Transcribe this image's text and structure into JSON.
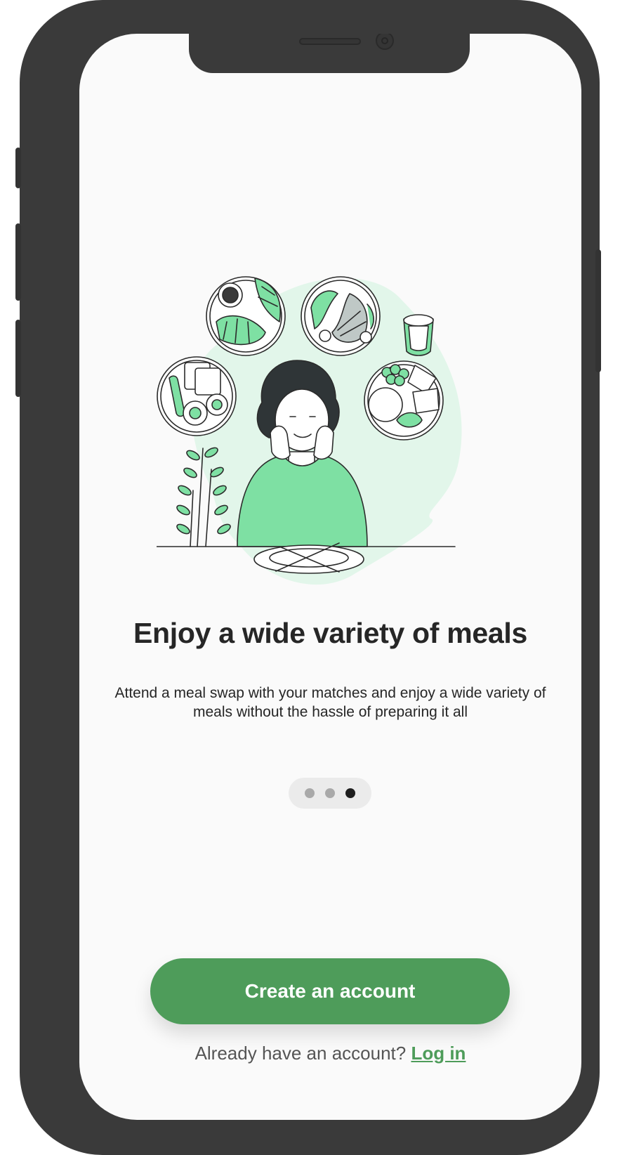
{
  "onboarding": {
    "title": "Enjoy a wide variety of meals",
    "subtitle": "Attend a meal swap with your matches and enjoy a wide variety of meals without the hassle of preparing it all",
    "page_indicator": {
      "total": 3,
      "active": 3
    },
    "create_account_label": "Create an account",
    "login_prompt": "Already have an account?",
    "login_link_label": "Log in"
  },
  "colors": {
    "accent": "#4e9c5a",
    "illustration_green": "#7ee0a3",
    "illustration_bg": "#e2f6ea",
    "text": "#262626",
    "device_frame": "#3a3a3a"
  }
}
